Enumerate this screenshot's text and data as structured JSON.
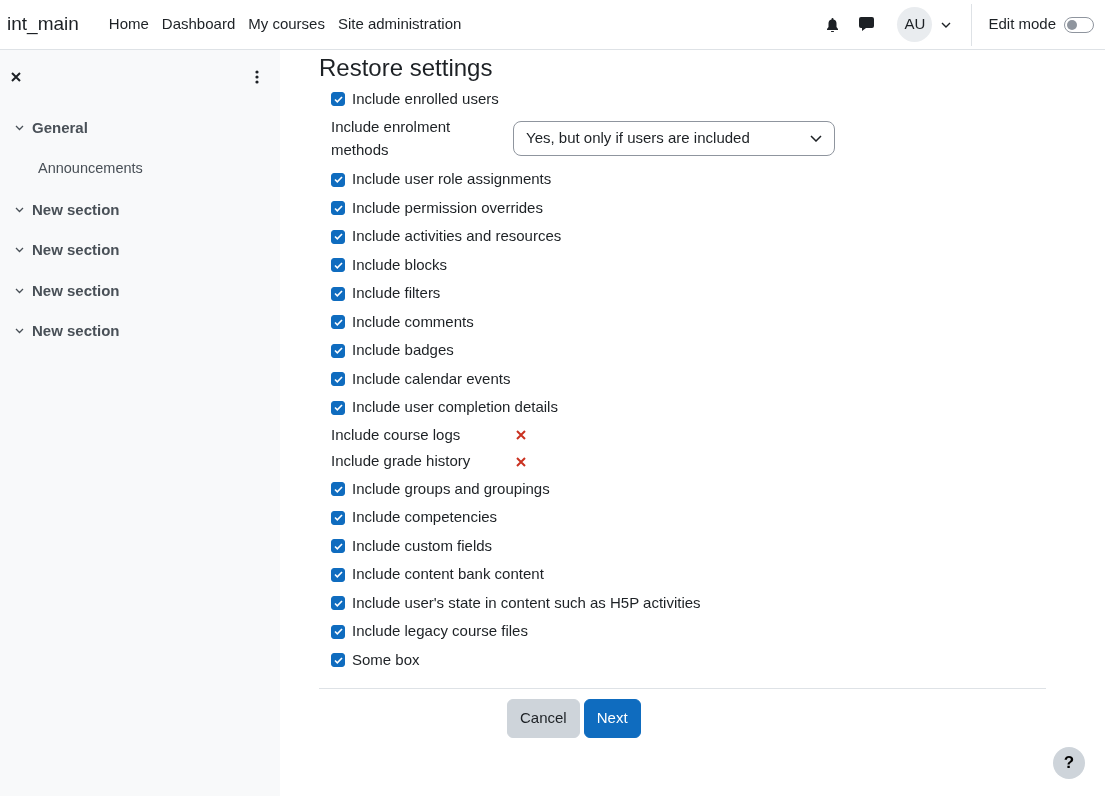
{
  "navbar": {
    "brand": "int_main",
    "links": [
      "Home",
      "Dashboard",
      "My courses",
      "Site administration"
    ],
    "avatar": "AU",
    "edit_mode": {
      "label": "Edit mode",
      "on": false
    }
  },
  "sidebar": {
    "sections": [
      {
        "title": "General",
        "expanded": true,
        "children": [
          {
            "title": "Announcements"
          }
        ]
      },
      {
        "title": "New section",
        "expanded": true
      },
      {
        "title": "New section",
        "expanded": true
      },
      {
        "title": "New section",
        "expanded": true
      },
      {
        "title": "New section",
        "expanded": true
      }
    ]
  },
  "page": {
    "title": "Restore settings",
    "settings": [
      {
        "kind": "checkbox",
        "label": "Include enrolled users",
        "checked": true
      },
      {
        "kind": "select",
        "label": "Include enrolment methods",
        "value": "Yes, but only if users are included"
      },
      {
        "kind": "checkbox",
        "label": "Include user role assignments",
        "checked": true
      },
      {
        "kind": "checkbox",
        "label": "Include permission overrides",
        "checked": true
      },
      {
        "kind": "checkbox",
        "label": "Include activities and resources",
        "checked": true
      },
      {
        "kind": "checkbox",
        "label": "Include blocks",
        "checked": true
      },
      {
        "kind": "checkbox",
        "label": "Include filters",
        "checked": true
      },
      {
        "kind": "checkbox",
        "label": "Include comments",
        "checked": true
      },
      {
        "kind": "checkbox",
        "label": "Include badges",
        "checked": true
      },
      {
        "kind": "checkbox",
        "label": "Include calendar events",
        "checked": true
      },
      {
        "kind": "checkbox",
        "label": "Include user completion details",
        "checked": true
      },
      {
        "kind": "static",
        "label": "Include course logs"
      },
      {
        "kind": "static",
        "label": "Include grade history"
      },
      {
        "kind": "checkbox",
        "label": "Include groups and groupings",
        "checked": true
      },
      {
        "kind": "checkbox",
        "label": "Include competencies",
        "checked": true
      },
      {
        "kind": "checkbox",
        "label": "Include custom fields",
        "checked": true
      },
      {
        "kind": "checkbox",
        "label": "Include content bank content",
        "checked": true
      },
      {
        "kind": "checkbox",
        "label": "Include user's state in content such as H5P activities",
        "checked": true
      },
      {
        "kind": "checkbox",
        "label": "Include legacy course files",
        "checked": true
      },
      {
        "kind": "checkbox",
        "label": "Some box",
        "checked": true
      }
    ],
    "buttons": [
      {
        "label": "Cancel",
        "kind": "secondary"
      },
      {
        "label": "Next",
        "kind": "primary"
      }
    ]
  },
  "help": {
    "label": "?"
  }
}
